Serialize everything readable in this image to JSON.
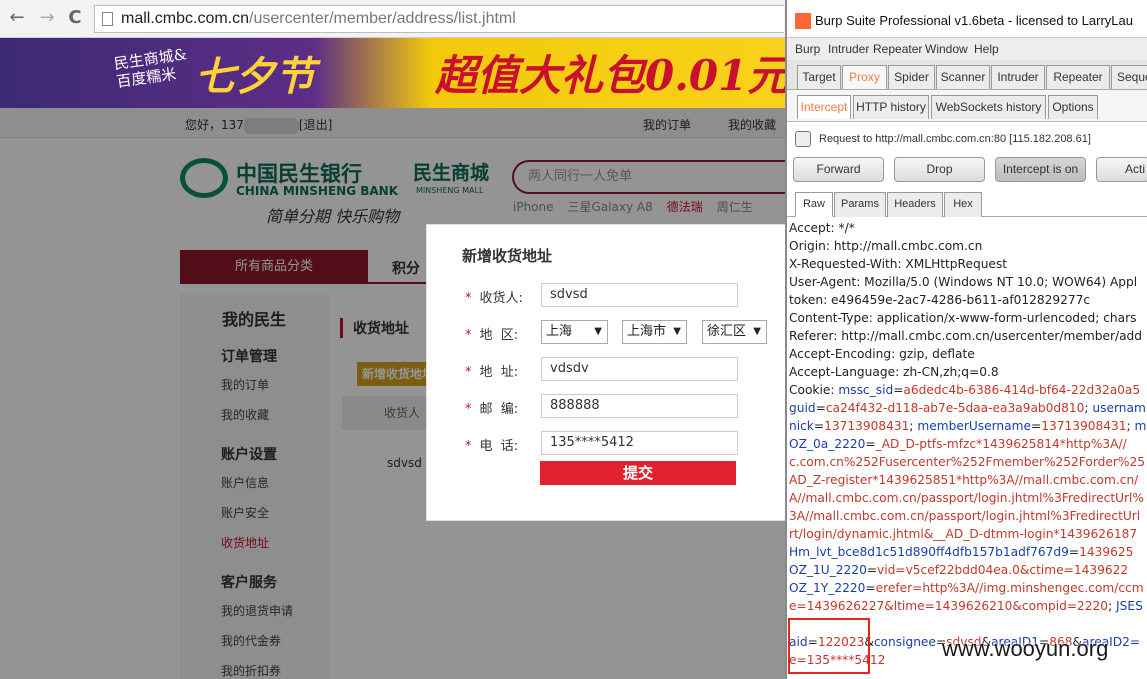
{
  "browser": {
    "url_domain": "mall.cmbc.com.cn",
    "url_path": "/usercenter/member/address/list.jhtml",
    "back": "←",
    "forward": "→",
    "reload": "C"
  },
  "banner": {
    "slogan_line1": "民生商城&",
    "slogan_line2": "百度糯米",
    "qixi": "七夕节",
    "promo": "超值大礼包0.01元"
  },
  "topbar": {
    "greeting": "您好，",
    "user_prefix": "137",
    "logout": "[退出]",
    "my_orders": "我的订单",
    "my_favorites": "我的收藏"
  },
  "logo": {
    "bank_cn": "中国民生银行",
    "bank_en": "CHINA MINSHENG BANK",
    "mall_cn": "民生商城",
    "mall_en": "MINSHENG MALL",
    "tagline": "简单分期 快乐购物"
  },
  "search": {
    "placeholder": "两人同行一人免单",
    "hot_words": [
      "iPhone",
      "三星Galaxy A8",
      "德法瑞",
      "周仁生"
    ]
  },
  "nav": {
    "all_categories": "所有商品分类",
    "points": "积分"
  },
  "sidebar": {
    "title": "我的民生",
    "order_header": "订单管理",
    "my_orders": "我的订单",
    "my_favorites": "我的收藏",
    "account_header": "账户设置",
    "account_info": "账户信息",
    "account_security": "账户安全",
    "shipping_address": "收货地址",
    "service_header": "客户服务",
    "returns": "我的退货申请",
    "vouchers": "我的代金券",
    "discount_coupons": "我的折扣券"
  },
  "content": {
    "title": "收货地址",
    "add_button": "新增收货地址",
    "col_consignee": "收货人",
    "row_consignee": "sdvsd"
  },
  "modal": {
    "title": "新增收货地址",
    "required": "*",
    "label_consignee": "收货人:",
    "value_consignee": "sdvsd",
    "label_region": "地  区:",
    "province": "上海",
    "city": "上海市",
    "district": "徐汇区",
    "label_address": "地  址:",
    "value_address": "vdsdv",
    "label_zip": "邮  编:",
    "value_zip": "888888",
    "label_phone": "电  话:",
    "value_phone": "135****5412",
    "submit": "提交"
  },
  "burp": {
    "title": "Burp Suite Professional v1.6beta - licensed to LarryLau",
    "menu": [
      "Burp",
      "Intruder",
      "Repeater",
      "Window",
      "Help"
    ],
    "tabs": [
      "Target",
      "Proxy",
      "Spider",
      "Scanner",
      "Intruder",
      "Repeater",
      "Seque"
    ],
    "subtabs": [
      "Intercept",
      "HTTP history",
      "WebSockets history",
      "Options"
    ],
    "request_info": "Request to http://mall.cmbc.com.cn:80  [115.182.208.61]",
    "buttons": [
      "Forward",
      "Drop",
      "Intercept is on",
      "Acti"
    ],
    "view_tabs": [
      "Raw",
      "Params",
      "Headers",
      "Hex"
    ],
    "request_lines": [
      "Accept: */*",
      "Origin: http://mall.cmbc.com.cn",
      "X-Requested-With: XMLHttpRequest",
      "User-Agent: Mozilla/5.0 (Windows NT 10.0; WOW64) Appl",
      "token: e496459e-2ac7-4286-b611-af012829277c",
      "Content-Type: application/x-www-form-urlencoded; chars",
      "Referer: http://mall.cmbc.com.cn/usercenter/member/add",
      "Accept-Encoding: gzip, deflate",
      "Accept-Language: zh-CN,zh;q=0.8"
    ],
    "cookie_label": "Cookie: ",
    "cookie_lines": [
      {
        "k": "mssc_sid",
        "v": "a6dedc4b-6386-414d-bf64-22d32a0a5"
      },
      {
        "k": "guid",
        "v": "ca24f432-d118-ab7e-5daa-ea3a9ab0d810",
        "k2": "usernam"
      },
      {
        "k": "nick",
        "v": "13713908431",
        "k2": "memberUsername",
        "v2": "13713908431",
        "k3": "m"
      },
      {
        "k": "OZ_0a_2220",
        "v": "_AD_D-ptfs-mfzc*1439625814*http%3A//"
      },
      {
        "v": "c.com.cn%252Fusercenter%252Fmember%252Forder%25"
      },
      {
        "v": "AD_Z-register*1439625851*http%3A//mall.cmbc.com.cn/"
      },
      {
        "v": "A//mall.cmbc.com.cn/passport/login.jhtml%3FredirectUrl%"
      },
      {
        "v": "3A//mall.cmbc.com.cn/passport/login.jhtml%3FredirectUrl"
      },
      {
        "v": "rt/login/dynamic.jhtml&__AD_D-dtmm-login*1439626187"
      },
      {
        "k": "Hm_lvt_bce8d1c51d890ff4dfb157b1adf767d9",
        "v": "1439625"
      },
      {
        "k": "OZ_1U_2220",
        "v": "vid=v5cef22bdd04ea.0&ctime=1439622"
      },
      {
        "k": "OZ_1Y_2220",
        "v": "erefer=http%3A//img.minshengec.com/ccm"
      },
      {
        "v": "e=1439626227&ltime=1439626210&compid=2220",
        "k2": "JSES"
      }
    ],
    "body_line1_key": "aid",
    "body_line1_val": "122023",
    "body_line1_rest_key": "consignee",
    "body_line1_rest_val": "sdvsd",
    "body_line1_tail_key": "areaID1",
    "body_line1_tail_val": "868",
    "body_line1_end": "areaID2=",
    "body_line2": "e=135****5412"
  },
  "watermark": "www.wooyun.org"
}
